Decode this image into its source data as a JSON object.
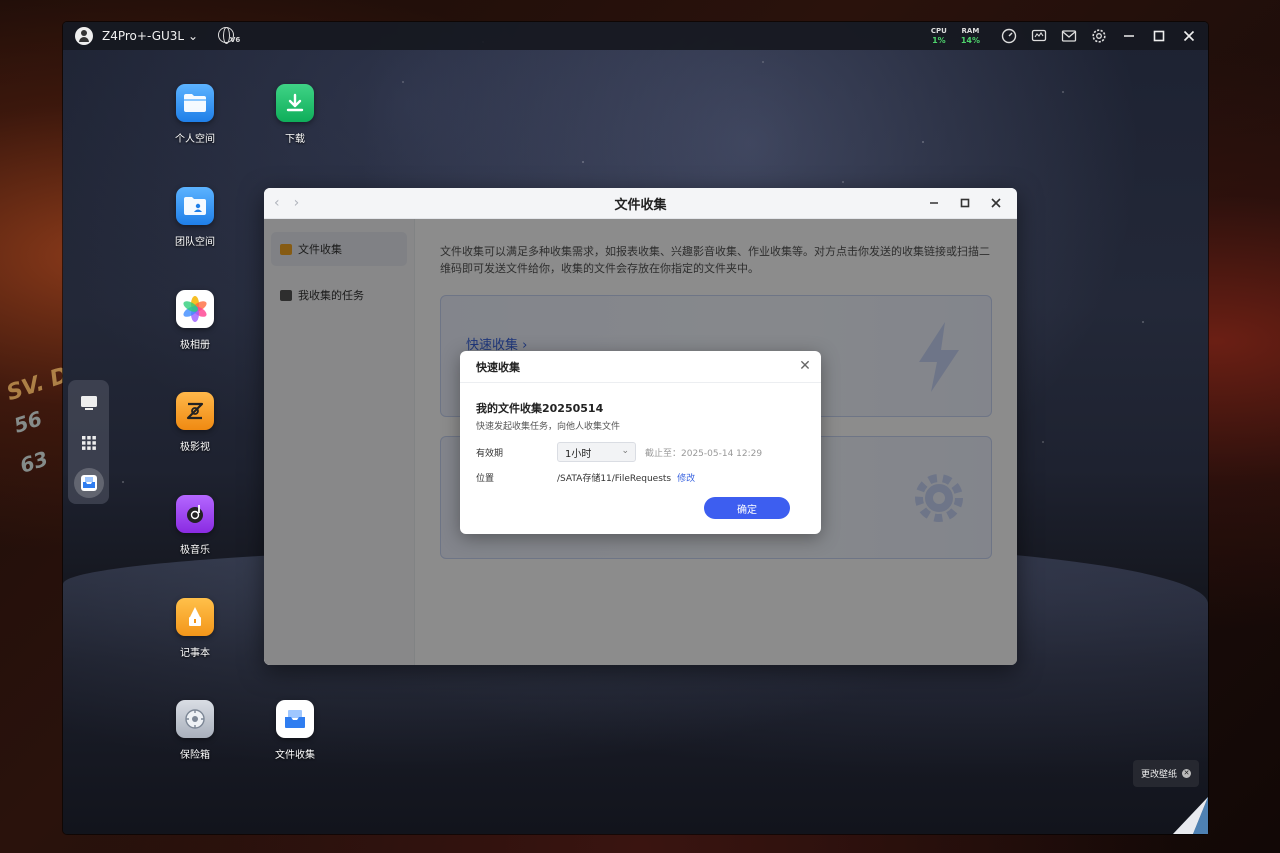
{
  "topbar": {
    "device_name": "Z4Pro+-GU3L",
    "ipv6_badge": "V6",
    "cpu_label": "CPU",
    "cpu_value": "1%",
    "ram_label": "RAM",
    "ram_value": "14%",
    "icons": [
      "speed-icon",
      "monitor-icon",
      "mail-icon",
      "gear-icon",
      "minimize-icon",
      "maximize-icon",
      "close-icon"
    ]
  },
  "desktop_icons": [
    {
      "label": "个人空间",
      "icon": "folder-icon"
    },
    {
      "label": "下载",
      "icon": "download-icon"
    },
    {
      "label": "团队空间",
      "icon": "team-folder-icon"
    },
    {
      "label": "极相册",
      "icon": "photos-icon"
    },
    {
      "label": "极影视",
      "icon": "video-icon"
    },
    {
      "label": "极音乐",
      "icon": "music-icon"
    },
    {
      "label": "记事本",
      "icon": "notes-icon"
    },
    {
      "label": "保险箱",
      "icon": "safe-icon"
    },
    {
      "label": "文件收集",
      "icon": "file-collect-icon"
    }
  ],
  "app": {
    "title": "文件收集",
    "sidebar": [
      {
        "label": "文件收集",
        "active": true
      },
      {
        "label": "我收集的任务",
        "active": false
      }
    ],
    "intro": "文件收集可以满足多种收集需求，如报表收集、兴趣影音收集、作业收集等。对方点击你发送的收集链接或扫描二维码即可发送文件给你，收集的文件会存放在你指定的文件夹中。",
    "card1_title": "快速收集 ›"
  },
  "modal": {
    "title": "快速收集",
    "task_name": "我的文件收集20250514",
    "subtitle": "快速发起收集任务，向他人收集文件",
    "validity_label": "有效期",
    "validity_value": "1小时",
    "deadline": "截止至：2025-05-14 12:29",
    "location_label": "位置",
    "location_path": "/SATA存储11/FileRequests",
    "edit_label": "修改",
    "confirm_label": "确定"
  },
  "wallpaper": {
    "change_label": "更改壁纸"
  },
  "hud": {
    "t1": "SV. D",
    "t2": "56",
    "t3": "63"
  },
  "colors": {
    "accent": "#3d5ef0",
    "link": "#3a64e0",
    "cpu_ok": "#4dd26b"
  }
}
